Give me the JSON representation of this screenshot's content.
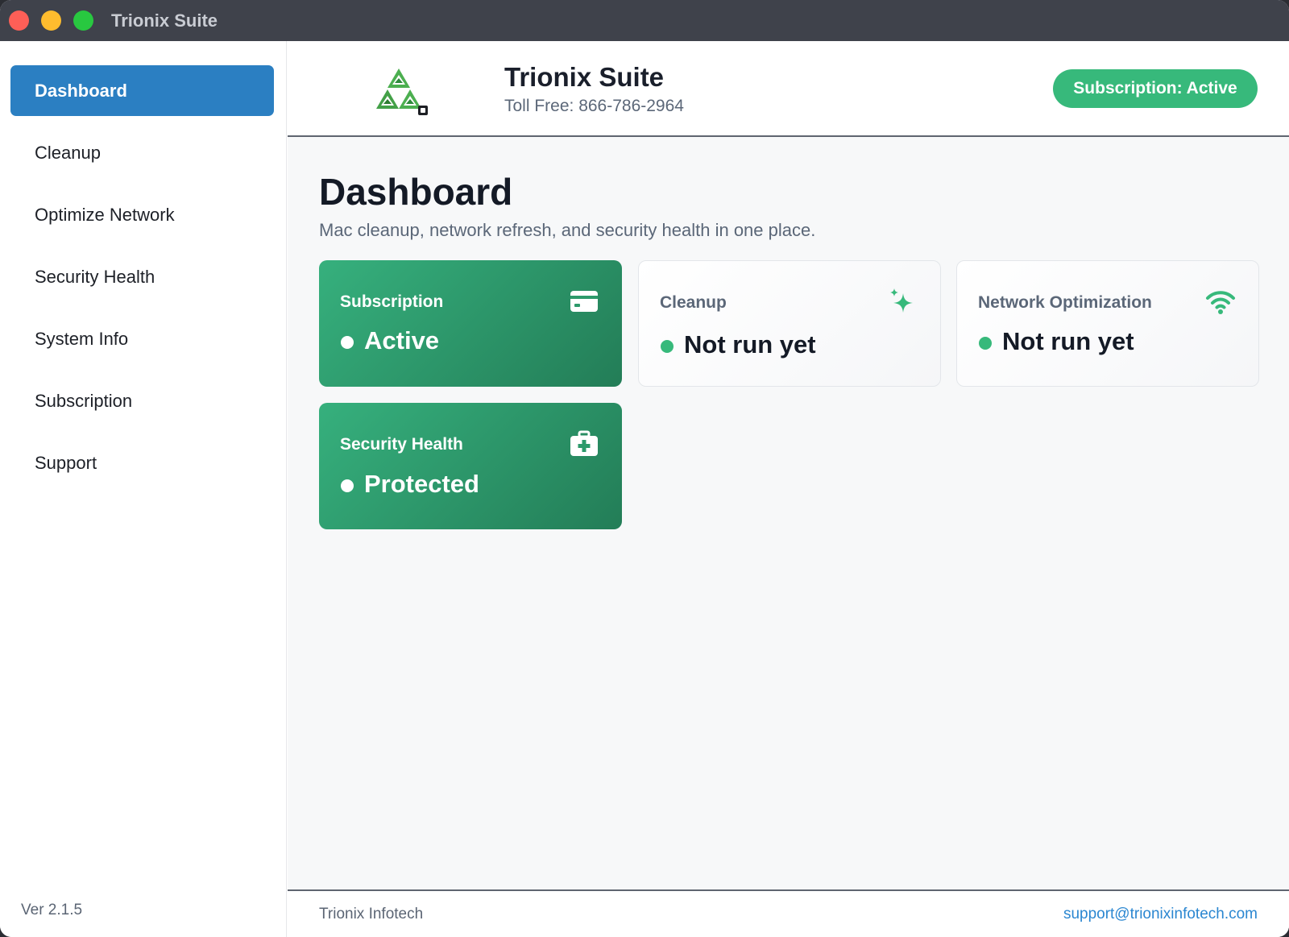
{
  "window": {
    "title": "Trionix Suite",
    "controls": [
      "close",
      "minimize",
      "zoom"
    ]
  },
  "sidebar": {
    "items": [
      {
        "label": "Dashboard",
        "active": true
      },
      {
        "label": "Cleanup",
        "active": false
      },
      {
        "label": "Optimize Network",
        "active": false
      },
      {
        "label": "Security Health",
        "active": false
      },
      {
        "label": "System Info",
        "active": false
      },
      {
        "label": "Subscription",
        "active": false
      },
      {
        "label": "Support",
        "active": false
      }
    ],
    "version": "Ver 2.1.5"
  },
  "header": {
    "logo_icon": "triangle-logo-icon",
    "brand_name": "Trionix Suite",
    "phone": "Toll Free: 866-786-2964",
    "subscription_pill": "Subscription: Active"
  },
  "page": {
    "title": "Dashboard",
    "subtitle": "Mac cleanup, network refresh, and security health in one place."
  },
  "cards": [
    {
      "title": "Subscription",
      "status": "Active",
      "icon": "credit-card-icon",
      "style": "green"
    },
    {
      "title": "Cleanup",
      "status": "Not run yet",
      "icon": "sparkle-icon",
      "style": "white"
    },
    {
      "title": "Network Optimization",
      "status": "Not run yet",
      "icon": "wifi-icon",
      "style": "white"
    },
    {
      "title": "Security Health",
      "status": "Protected",
      "icon": "medical-kit-icon",
      "style": "green"
    }
  ],
  "footer": {
    "company": "Trionix Infotech",
    "email": "support@trionixinfotech.com"
  },
  "colors": {
    "accent_blue": "#2b7fc2",
    "accent_green": "#37b97b",
    "link_blue": "#2b87d1",
    "titlebar": "#3f424b"
  }
}
